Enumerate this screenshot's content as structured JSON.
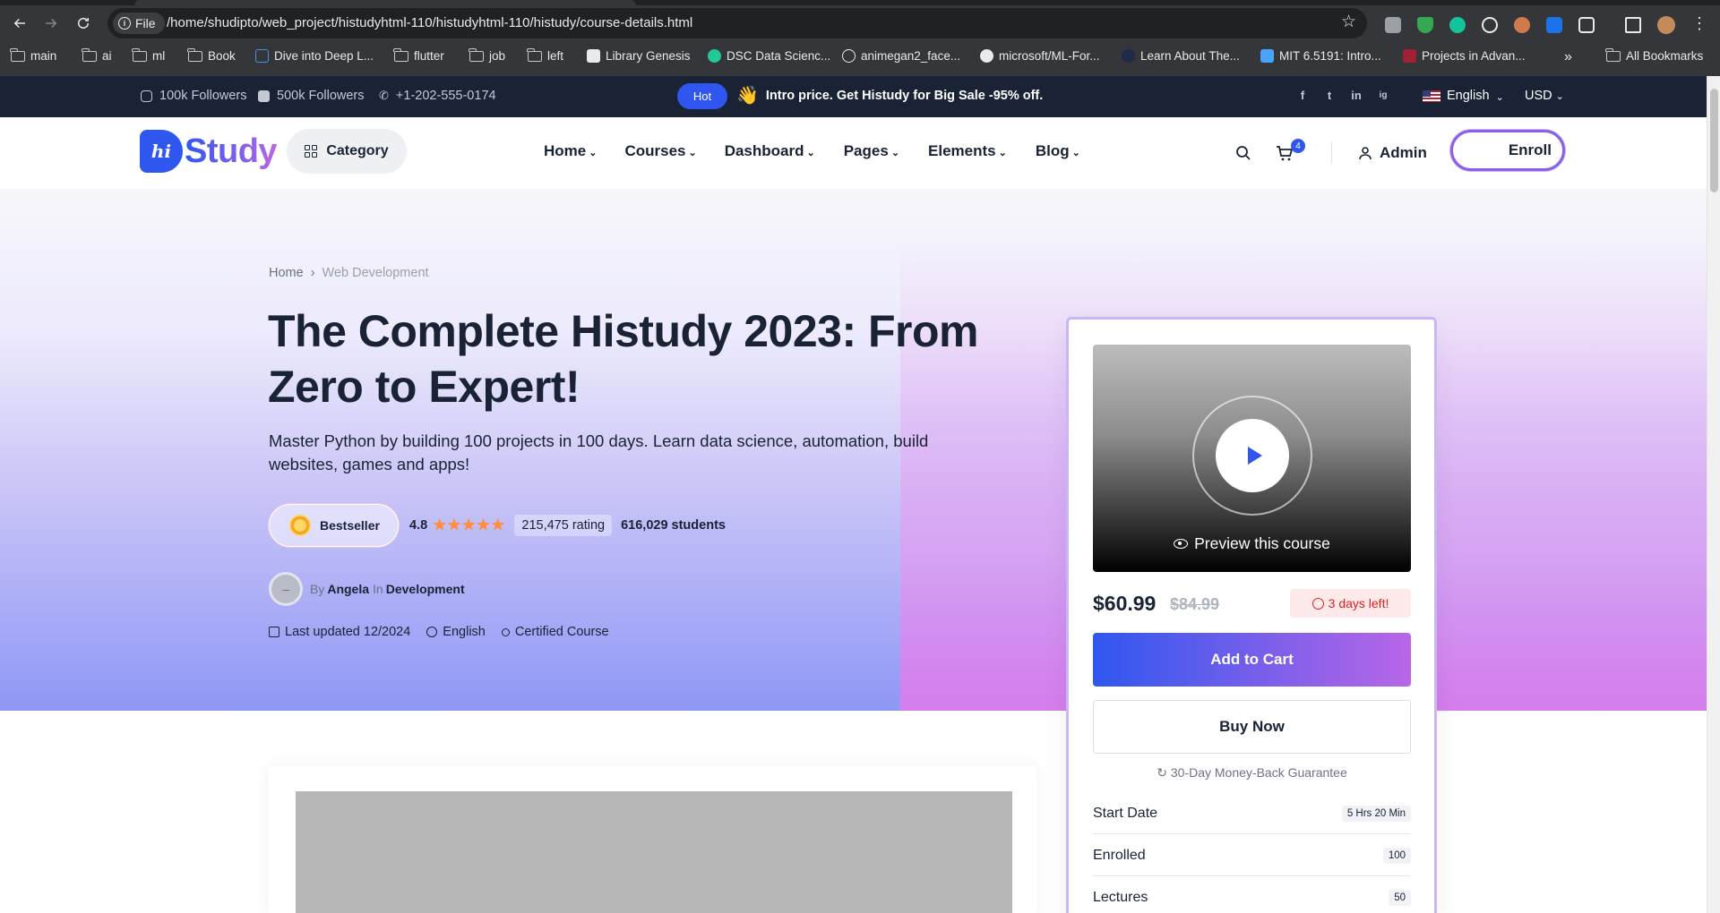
{
  "browser": {
    "chip_label": "File",
    "url": "/home/shudipto/web_project/histudyhtml-110/histudyhtml-110/histudy/course-details.html",
    "bookmarks": [
      "main",
      "ai",
      "ml",
      "Book",
      "Dive into Deep L...",
      "flutter",
      "job",
      "left",
      "Library Genesis",
      "DSC Data Scienc...",
      "animegan2_face...",
      "microsoft/ML-For...",
      "Learn About The...",
      "MIT 6.5191: Intro...",
      "Projects in Advan..."
    ],
    "bookmarks_overflow": "»",
    "all_bookmarks": "All Bookmarks"
  },
  "infobar": {
    "instagram_followers": "100k Followers",
    "facebook_followers": "500k Followers",
    "phone": "+1-202-555-0174",
    "hot_badge": "Hot",
    "promo_emoji": "👋",
    "promo_text": "Intro price. Get Histudy for Big Sale -95% off.",
    "social_icons": [
      "f",
      "t",
      "in",
      "ig"
    ],
    "language": "English",
    "currency": "USD"
  },
  "header": {
    "logo_mark": "hi",
    "logo_text": "Study",
    "category_label": "Category",
    "menu": [
      "Home",
      "Courses",
      "Dashboard",
      "Pages",
      "Elements",
      "Blog"
    ],
    "cart_count": "4",
    "admin_label": "Admin",
    "enroll_label": "Enroll"
  },
  "hero": {
    "breadcrumb": {
      "home": "Home",
      "sep": "›",
      "current": "Web Development"
    },
    "title": "The Complete Histudy 2023: From Zero to Expert!",
    "description": "Master Python by building 100 projects in 100 days. Learn data science, automation, build websites, games and apps!",
    "badge": "Bestseller",
    "rating_value": "4.8",
    "stars": "★★★★★",
    "rating_count": "215,475 rating",
    "students": "616,029 students",
    "author_avatar": "–",
    "by_label": "By",
    "author": "Angela",
    "in_label": "In",
    "category": "Development",
    "last_updated": "Last updated 12/2024",
    "language": "English",
    "certificate": "Certified Course"
  },
  "sidebar": {
    "preview_label": "Preview this course",
    "price": "$60.99",
    "old_price": "$84.99",
    "days_left": "3 days left!",
    "add_to_cart": "Add to Cart",
    "buy_now": "Buy Now",
    "guarantee": "30-Day Money-Back Guarantee",
    "details": [
      {
        "label": "Start Date",
        "value": "5 Hrs 20 Min"
      },
      {
        "label": "Enrolled",
        "value": "100"
      },
      {
        "label": "Lectures",
        "value": "50"
      }
    ]
  },
  "colors": {
    "primary": "#2f57ef",
    "secondary": "#b966e7",
    "heading": "#192335",
    "topbar": "#192335"
  }
}
